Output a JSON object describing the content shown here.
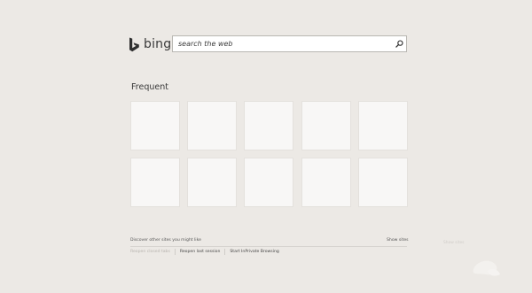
{
  "logo": {
    "wordmark": "bing"
  },
  "search": {
    "placeholder": "search the web",
    "value": ""
  },
  "frequent": {
    "title": "Frequent",
    "tiles": [
      "",
      "",
      "",
      "",
      "",
      "",
      "",
      "",
      "",
      ""
    ]
  },
  "footer": {
    "discover_label": "Discover other sites you might like",
    "show_sites_label": "Show sites",
    "faded_right_label": "Show sites",
    "actions": {
      "reopen_closed_label": "Reopen closed tabs",
      "reopen_session_label": "Reopen last session",
      "inprivate_label": "Start InPrivate Browsing"
    }
  },
  "colors": {
    "background": "#ece9e5",
    "tile": "#f8f7f6",
    "bing_logo": "#2f2f2f"
  }
}
